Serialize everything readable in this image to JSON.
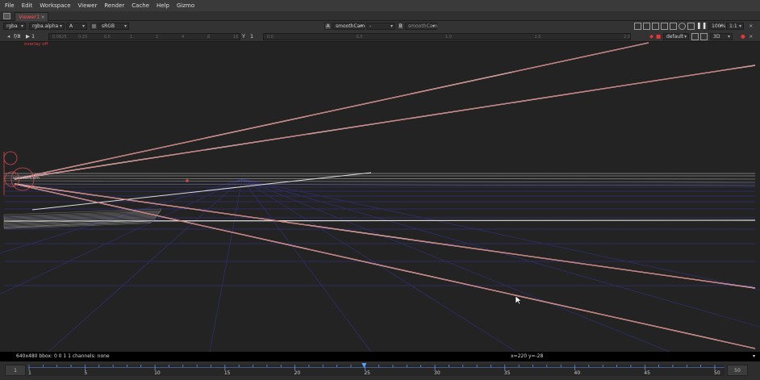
{
  "menu": [
    "File",
    "Edit",
    "Workspace",
    "Viewer",
    "Render",
    "Cache",
    "Help",
    "Gizmo"
  ],
  "tab": {
    "label": "Viewer1",
    "close": "×"
  },
  "toolbar1": {
    "channels": "rgba",
    "alpha": "rgba.alpha",
    "input_a": "A",
    "colorspace": "sRGB",
    "a_badge": "A",
    "a_input": "smoothCam",
    "a_op": "-",
    "b_badge": "B",
    "b_input": "smoothCam",
    "zoom": "100%",
    "ratio": "1:1"
  },
  "toolbar2": {
    "fstop": "f/8",
    "frame_arrow": "▶",
    "frame": "1",
    "y_label": "Y",
    "y_value": "1",
    "lut": "default",
    "view_mode": "3D",
    "left_ticks": [
      "0.0625",
      "0.25",
      "0.5",
      "1",
      "2",
      "4",
      "8",
      "16"
    ],
    "right_ticks": [
      "0.0",
      "0.5",
      "1.0",
      "1.5",
      "2.0"
    ]
  },
  "viewport": {
    "format": "overlay off",
    "camera": "smoothCam"
  },
  "status": {
    "left": "640x480  bbox: 0 0 1 1  channels: none",
    "right": "x=220 y=-28"
  },
  "timeline": {
    "start": "1",
    "end": "50",
    "labels": [
      "1",
      "5",
      "10",
      "15",
      "20",
      "25",
      "30",
      "35",
      "40",
      "45",
      "50"
    ],
    "current": 25
  },
  "colors": {
    "frustum_outer": "#e8e8e8",
    "frustum_inner": "#d93535",
    "grid": "#2f2f74",
    "ground": "#c9c9c9"
  }
}
